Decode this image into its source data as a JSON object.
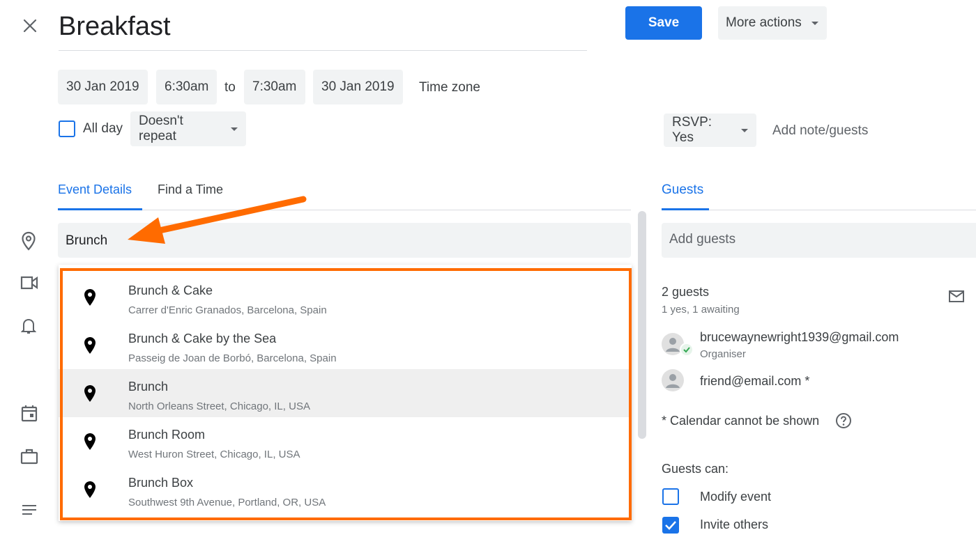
{
  "header": {
    "close_icon": "close-icon",
    "title": "Breakfast",
    "save_label": "Save",
    "more_actions_label": "More actions"
  },
  "datetime": {
    "start_date": "30 Jan 2019",
    "start_time": "6:30am",
    "to_label": "to",
    "end_time": "7:30am",
    "end_date": "30 Jan 2019",
    "timezone_label": "Time zone",
    "all_day_label": "All day",
    "repeat_value": "Doesn't repeat"
  },
  "rsvp": {
    "value": "RSVP: Yes",
    "add_note_label": "Add note/guests"
  },
  "tabs": {
    "event_details": "Event Details",
    "find_time": "Find a Time",
    "guests": "Guests"
  },
  "location": {
    "value": "Brunch"
  },
  "suggestions": [
    {
      "name": "Brunch & Cake",
      "address": "Carrer d'Enric Granados, Barcelona, Spain"
    },
    {
      "name": "Brunch & Cake by the Sea",
      "address": "Passeig de Joan de Borbó, Barcelona, Spain"
    },
    {
      "name": "Brunch",
      "address": "North Orleans Street, Chicago, IL, USA"
    },
    {
      "name": "Brunch Room",
      "address": "West Huron Street, Chicago, IL, USA"
    },
    {
      "name": "Brunch Box",
      "address": "Southwest 9th Avenue, Portland, OR, USA"
    }
  ],
  "guests": {
    "add_placeholder": "Add guests",
    "count": "2 guests",
    "status": "1 yes, 1 awaiting",
    "list": [
      {
        "email": "brucewaynewright1939@gmail.com",
        "role": "Organiser"
      },
      {
        "email": "friend@email.com *",
        "role": ""
      }
    ],
    "calendar_note": "* Calendar cannot be shown",
    "can_label": "Guests can:",
    "permissions": [
      {
        "label": "Modify event",
        "checked": false
      },
      {
        "label": "Invite others",
        "checked": true
      }
    ]
  },
  "colors": {
    "accent": "#1a73e8",
    "highlight": "#ff6b00"
  }
}
